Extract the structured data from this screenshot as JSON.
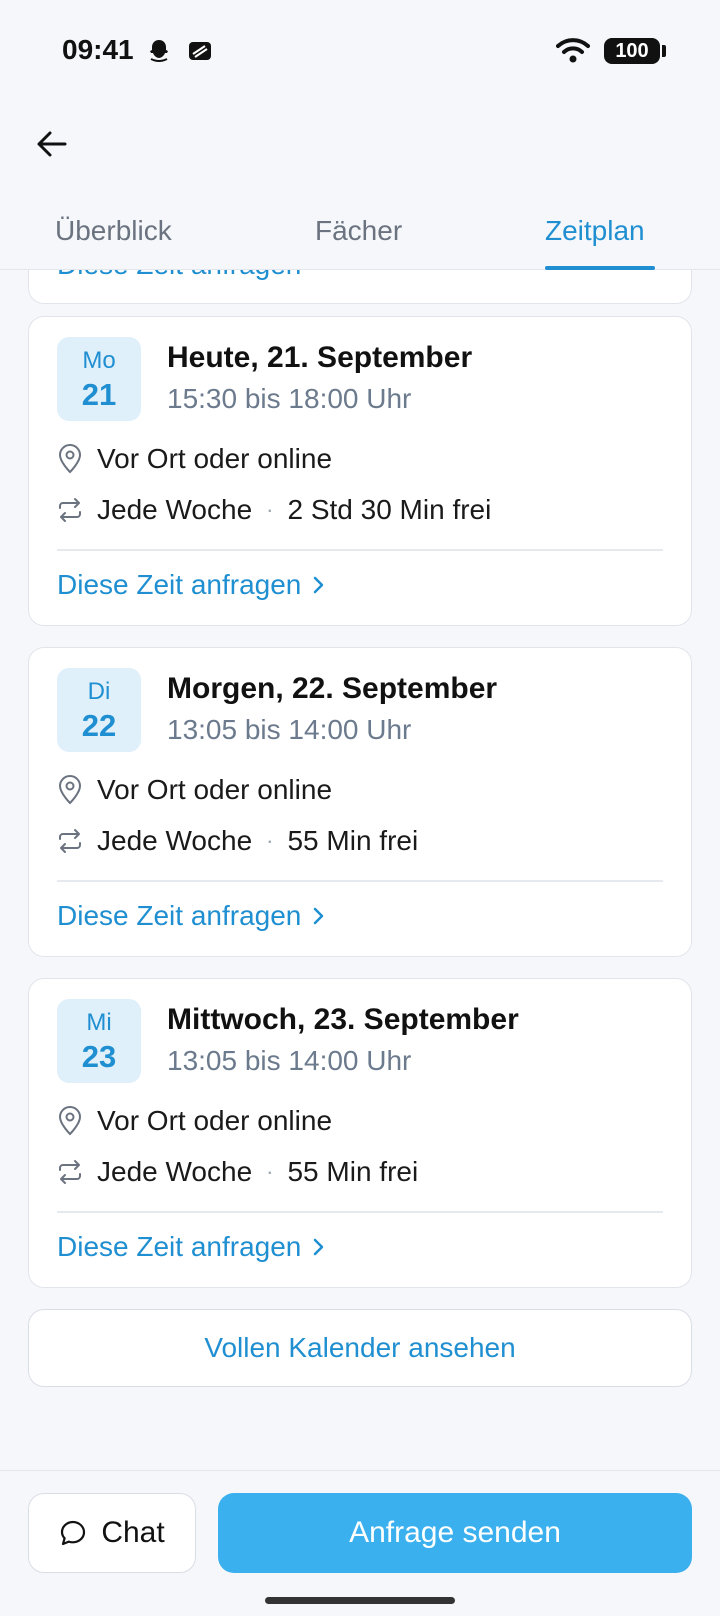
{
  "status_bar": {
    "time": "09:41",
    "battery": "100",
    "icons": [
      "snapchat-icon",
      "stack-icon",
      "wifi-icon",
      "battery-icon"
    ]
  },
  "header": {
    "back_icon": "arrow-left-icon",
    "tabs": [
      {
        "label": "Überblick",
        "active": false
      },
      {
        "label": "Fächer",
        "active": false
      },
      {
        "label": "Zeitplan",
        "active": true
      }
    ]
  },
  "previous_card": {
    "link_label": "Diese Zeit anfragen"
  },
  "slots": [
    {
      "day_abbr": "Mo",
      "day_num": "21",
      "title": "Heute, 21. September",
      "time": "15:30 bis 18:00 Uhr",
      "location": "Vor Ort oder online",
      "recurrence": "Jede Woche",
      "free": "2 Std 30 Min frei",
      "link_label": "Diese Zeit anfragen"
    },
    {
      "day_abbr": "Di",
      "day_num": "22",
      "title": "Morgen, 22. September",
      "time": "13:05 bis 14:00 Uhr",
      "location": "Vor Ort oder online",
      "recurrence": "Jede Woche",
      "free": "55 Min frei",
      "link_label": "Diese Zeit anfragen"
    },
    {
      "day_abbr": "Mi",
      "day_num": "23",
      "title": "Mittwoch, 23. September",
      "time": "13:05 bis 14:00 Uhr",
      "location": "Vor Ort oder online",
      "recurrence": "Jede Woche",
      "free": "55 Min frei",
      "link_label": "Diese Zeit anfragen"
    }
  ],
  "full_calendar_label": "Vollen Kalender ansehen",
  "bottom": {
    "chat_label": "Chat",
    "send_label": "Anfrage senden"
  },
  "colors": {
    "accent": "#1f8fd1",
    "primary_button": "#3bb0ef",
    "badge_bg": "#dff0fb",
    "background": "#f5f7fa"
  }
}
